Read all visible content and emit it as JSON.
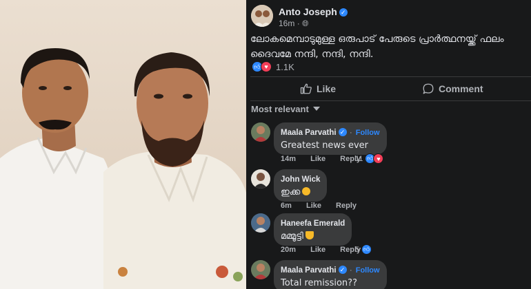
{
  "post": {
    "author": "Anto Joseph",
    "time": "16m",
    "audience_icon": "globe-icon",
    "text_line1": "ലോകമെമ്പാടുമുള്ള ഒരുപാട് പേരുടെ പ്രാർത്ഥനയ്ക്ക് ഫലം",
    "text_line2": "ദൈവമേ നന്ദി, നന്ദി, നന്ദി.",
    "reaction_count": "1.1K",
    "like_label": "Like",
    "comment_label": "Comment"
  },
  "comments_section": {
    "sort_label": "Most relevant",
    "comments": [
      {
        "name": "Maala Parvathi",
        "follow": "Follow",
        "text": "Greatest news ever",
        "time": "14m",
        "like": "Like",
        "reply": "Reply",
        "reactions": "11"
      },
      {
        "name": "John Wick",
        "text": "ഇക്ക",
        "time": "6m",
        "like": "Like",
        "reply": "Reply"
      },
      {
        "name": "Haneefa Emerald",
        "text": "മമ്മൂട്ടി",
        "time": "20m",
        "like": "Like",
        "reply": "Reply",
        "reactions": "5"
      },
      {
        "name": "Maala Parvathi",
        "follow": "Follow",
        "text": "Total remission??"
      }
    ]
  },
  "colors": {
    "background": "#18191a",
    "bubble": "#3a3b3c",
    "accent": "#2d88ff",
    "love": "#f33e58"
  }
}
